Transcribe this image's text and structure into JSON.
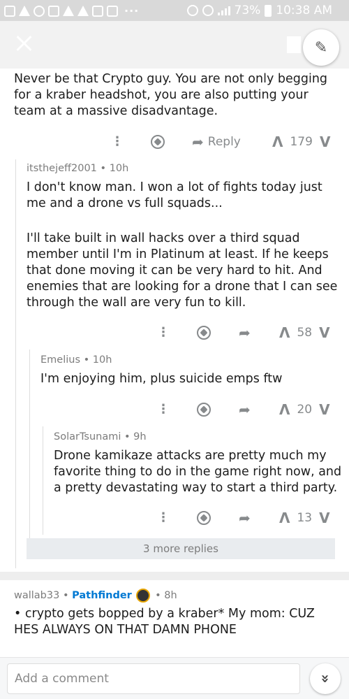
{
  "status_bar": {
    "battery": "73%",
    "time": "10:38 AM",
    "dots": "···"
  },
  "appbar": {
    "close_icon": "close-icon",
    "bookmark_icon": "bookmark-icon",
    "compose_icon": "compose-icon"
  },
  "comments": [
    {
      "text": "Never be that Crypto guy. You are not only begging for a  kraber headshot, you are also putting your team at a massive disadvantage.",
      "reply_label": "Reply",
      "score": "179"
    },
    {
      "author": "itsthejeff2001",
      "age": "10h",
      "text1": "I don't know man. I won a lot of fights today just me and a drone vs full squads...",
      "text2": "I'll take built in wall hacks over a third squad member until I'm in Platinum at least. If he keeps that done moving it can be very hard to hit. And enemies that are looking for a drone that I can see through the wall are very fun to kill.",
      "score": "58"
    },
    {
      "author": "Emelius",
      "age": "10h",
      "text": "I'm enjoying him, plus suicide emps ftw",
      "score": "20"
    },
    {
      "author": "SolarTsunami",
      "age": "9h",
      "text": "Drone kamikaze attacks are pretty much my favorite thing to do in the game right now, and a pretty devastating way to start a third party.",
      "score": "13"
    }
  ],
  "more_replies": "3 more replies",
  "next_comment": {
    "author": "wallab33",
    "flair": "Pathfinder",
    "age": "8h",
    "text": "• crypto gets bopped by a kraber* My mom: CUZ HES ALWAYS ON THAT DAMN PHONE"
  },
  "bottom": {
    "placeholder": "Add a comment"
  },
  "glyphs": {
    "kebab": "⋮",
    "reply_arrow": "➦",
    "upvote": "Λ",
    "downvote": "V",
    "bullet": "•",
    "compose": "✎",
    "chevrons": "»"
  }
}
